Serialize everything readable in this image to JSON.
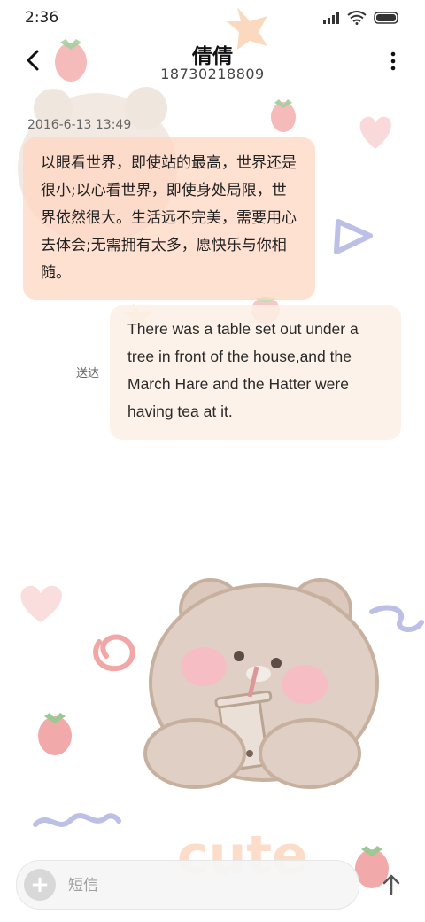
{
  "status_bar": {
    "time": "2:36",
    "icons": [
      "signal-icon",
      "wifi-icon",
      "battery-icon"
    ]
  },
  "header": {
    "back_icon": "back-arrow-icon",
    "contact_name": "倩倩",
    "contact_number": "18730218809",
    "more_icon": "more-vertical-icon"
  },
  "messages": [
    {
      "direction": "incoming",
      "timestamp": "2016-6-13 13:49",
      "text": "以眼看世界，即使站的最高，世界还是很小;以心看世界，即使身处局限，世界依然很大。生活远不完美，需要用心去体会;无需拥有太多，愿快乐与你相随。"
    },
    {
      "direction": "outgoing",
      "status": "送达",
      "text": "There was a table set out under a tree in front of the house,and the March Hare and the Hatter were having tea at it."
    }
  ],
  "composer": {
    "add_icon": "plus-icon",
    "placeholder": "短信",
    "value": "",
    "send_icon": "send-arrow-icon"
  },
  "wallpaper": {
    "theme": "cute bear with bubble tea",
    "watermark_text": "cute",
    "colors": {
      "bear": "#d9c3b6",
      "bear_outline": "#c2a894",
      "blush": "#f6b7be",
      "peach": "#f9c9a9",
      "lavender": "#b9bde0",
      "strawberry": "#ee9a9a"
    }
  }
}
